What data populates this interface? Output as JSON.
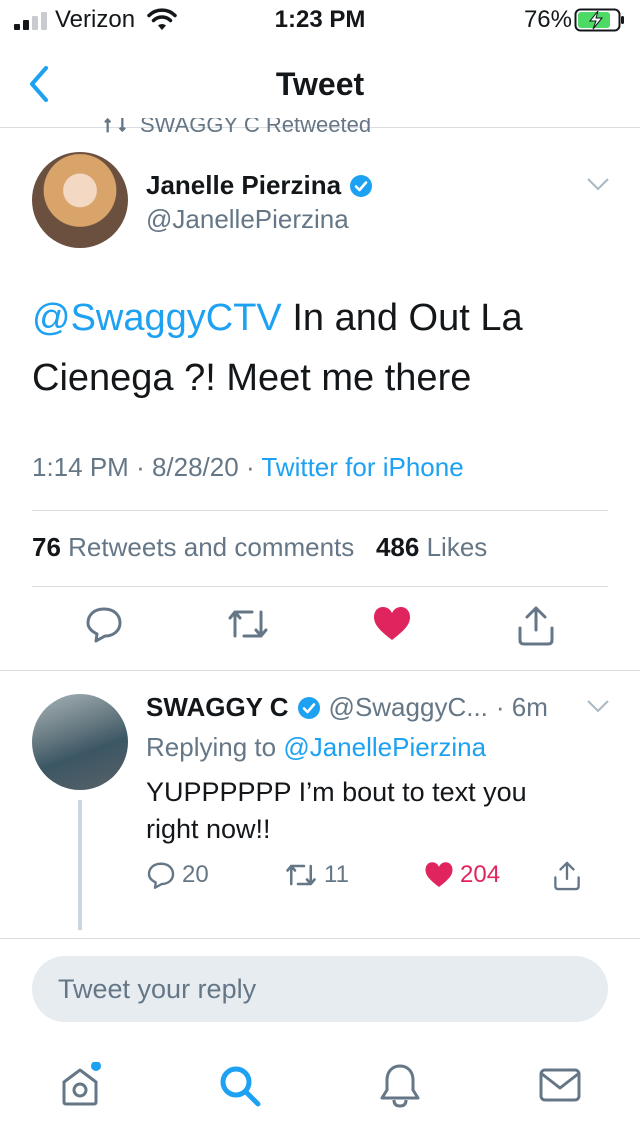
{
  "status_bar": {
    "carrier": "Verizon",
    "time": "1:23 PM",
    "battery_percent": "76%",
    "signal_icon": "signal-bars-icon",
    "wifi_icon": "wifi-icon",
    "battery_icon": "battery-charging-icon"
  },
  "nav": {
    "title": "Tweet",
    "back_icon": "chevron-left-icon"
  },
  "retweeted_banner": "SWAGGY C Retweeted",
  "main_tweet": {
    "author_name": "Janelle Pierzina",
    "author_handle": "@JanellePierzina",
    "verified": true,
    "mention": "@SwaggyCTV",
    "text": " In and Out La Cienega ?! Meet me there",
    "time": "1:14 PM",
    "date": "8/28/20",
    "source": "Twitter for iPhone",
    "retweets_count": "76",
    "retweets_label": "Retweets and comments",
    "likes_count": "486",
    "likes_label": "Likes",
    "liked": true
  },
  "reply_tweet": {
    "author_name": "SWAGGY C",
    "author_handle": "@SwaggyC...",
    "time_ago": "· 6m",
    "replying_to_label": "Replying to",
    "replying_to_handle": "@JanellePierzina",
    "text": "YUPPPPPP I’m bout to text you right now!!",
    "reply_count": "20",
    "retweet_count": "11",
    "like_count": "204",
    "liked": true
  },
  "reply_input": {
    "placeholder": "Tweet your reply"
  },
  "tabs": [
    "home-icon",
    "search-icon",
    "notifications-icon",
    "messages-icon"
  ],
  "colors": {
    "accent": "#1da1f2",
    "like": "#e0245e",
    "muted": "#657786",
    "battery_green": "#4cd964"
  }
}
